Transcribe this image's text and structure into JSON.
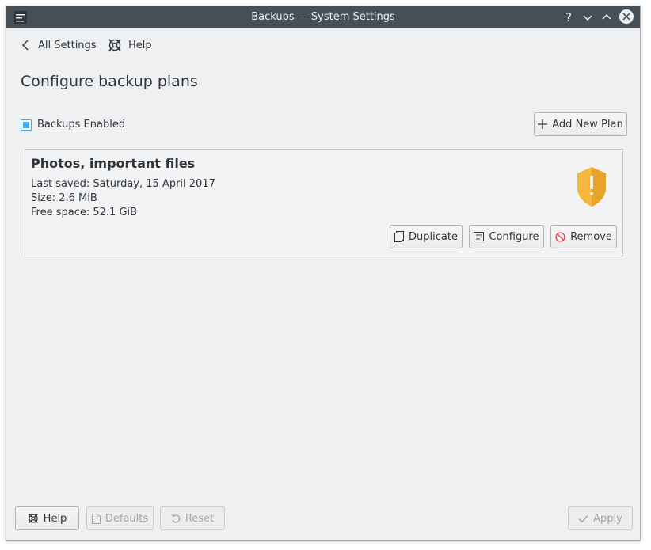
{
  "window": {
    "title": "Backups — System Settings"
  },
  "titlebar": {
    "help_glyph": "?",
    "minimize_glyph": "⌄",
    "maximize_glyph": "⌃"
  },
  "nav": {
    "back_label": "All Settings",
    "help_label": "Help"
  },
  "page": {
    "title": "Configure backup plans"
  },
  "backups": {
    "enabled_label": "Backups Enabled",
    "enabled": true
  },
  "toolbar": {
    "add_plan_label": "Add New Plan"
  },
  "plan": {
    "name": "Photos, important files",
    "last_saved": "Last saved: Saturday, 15 April 2017",
    "size": "Size: 2.6 MiB",
    "free_space": "Free space: 52.1 GiB",
    "status_icon": "warning-shield-icon",
    "duplicate_label": "Duplicate",
    "configure_label": "Configure",
    "remove_label": "Remove"
  },
  "footer": {
    "help_label": "Help",
    "defaults_label": "Defaults",
    "reset_label": "Reset",
    "apply_label": "Apply"
  },
  "colors": {
    "accent": "#3daee9",
    "titlebar": "#475057",
    "warning": "#f6b73c",
    "remove_icon": "#da4453"
  }
}
